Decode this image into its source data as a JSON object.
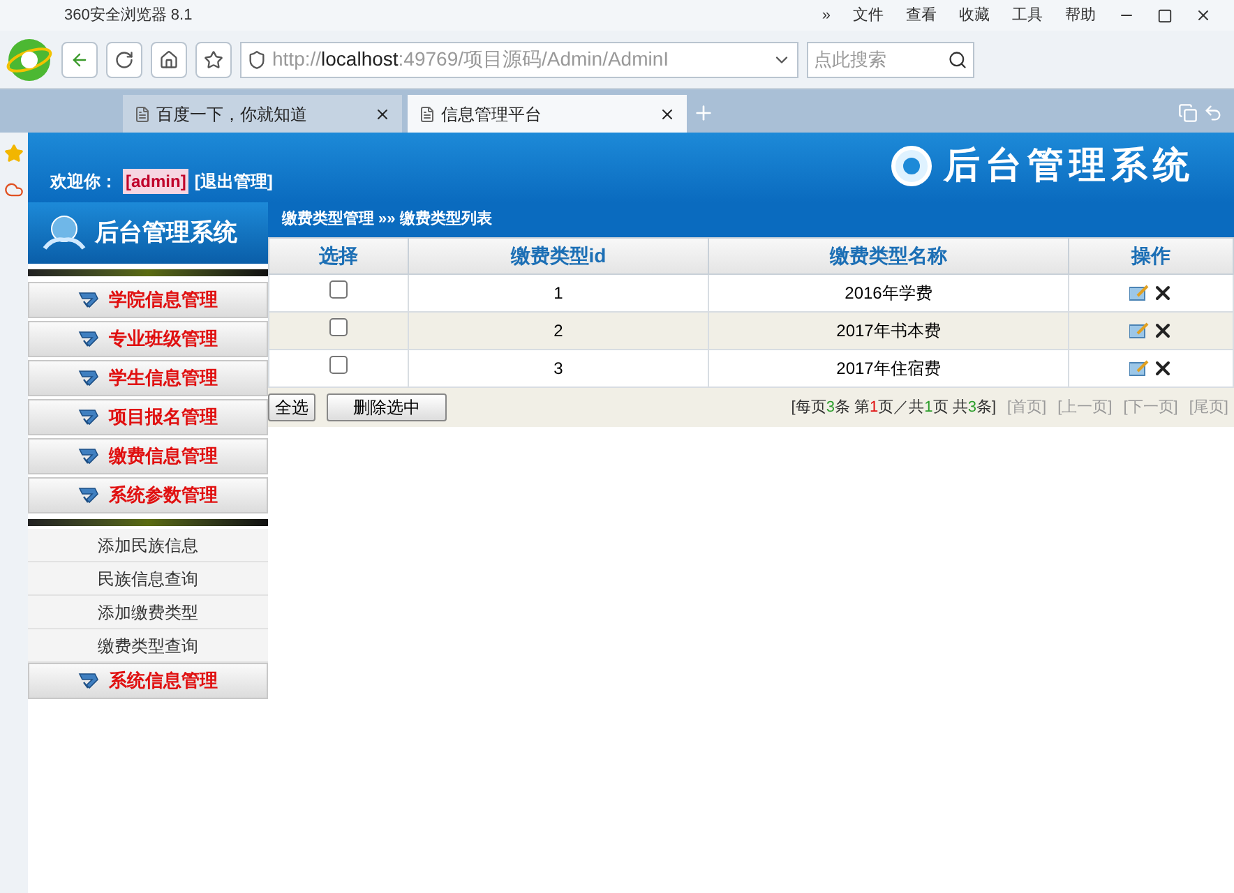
{
  "browser": {
    "title": "360安全浏览器 8.1",
    "menu": [
      "»",
      "文件",
      "查看",
      "收藏",
      "工具",
      "帮助"
    ],
    "address": {
      "scheme": "http://",
      "host": "localhost",
      "rest": ":49769/项目源码/Admin/AdminI"
    },
    "search": {
      "placeholder": "点此搜索"
    },
    "tabs": [
      {
        "label": "百度一下，你就知道",
        "selected": false
      },
      {
        "label": "信息管理平台",
        "selected": true
      }
    ]
  },
  "header": {
    "welcome": "欢迎你：",
    "user": "[admin]",
    "logout": "[退出管理]",
    "banner": "后台管理系统",
    "side_logo": "后台管理系统"
  },
  "breadcrumb": "缴费类型管理 »» 缴费类型列表",
  "sidebar": [
    {
      "label": "学院信息管理"
    },
    {
      "label": "专业班级管理"
    },
    {
      "label": "学生信息管理"
    },
    {
      "label": "项目报名管理"
    },
    {
      "label": "缴费信息管理"
    },
    {
      "label": "系统参数管理",
      "children": [
        "添加民族信息",
        "民族信息查询",
        "添加缴费类型",
        "缴费类型查询"
      ]
    },
    {
      "label": "系统信息管理"
    }
  ],
  "table": {
    "columns": [
      "选择",
      "缴费类型id",
      "缴费类型名称",
      "操作"
    ],
    "rows": [
      {
        "checked": false,
        "id": "1",
        "name": "2016年学费"
      },
      {
        "checked": false,
        "id": "2",
        "name": "2017年书本费"
      },
      {
        "checked": false,
        "id": "3",
        "name": "2017年住宿费"
      }
    ]
  },
  "buttons": [
    "全选",
    "删除选中"
  ],
  "pager": {
    "summary": [
      {
        "kind": "plain",
        "text": "[每页"
      },
      {
        "kind": "num",
        "text": "3"
      },
      {
        "kind": "plain",
        "text": "条 第"
      },
      {
        "kind": "cur",
        "text": "1"
      },
      {
        "kind": "plain",
        "text": "页／共"
      },
      {
        "kind": "num",
        "text": "1"
      },
      {
        "kind": "plain",
        "text": "页 共"
      },
      {
        "kind": "num",
        "text": "3"
      },
      {
        "kind": "plain",
        "text": "条]"
      }
    ],
    "links": [
      "[首页]",
      "[上一页]",
      "[下一页]",
      "[尾页]"
    ]
  }
}
